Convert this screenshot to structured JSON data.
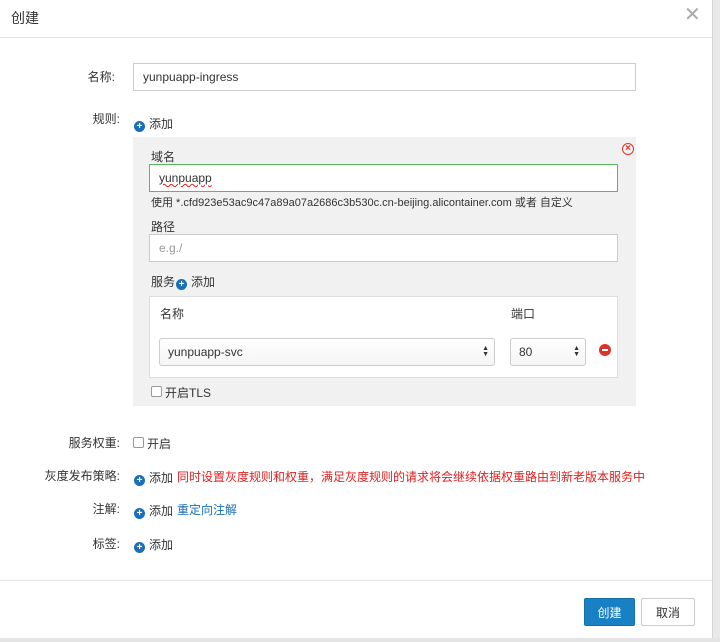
{
  "dialog": {
    "title": "创建",
    "close_glyph": "✕"
  },
  "form": {
    "name_label": "名称:",
    "name_value": "yunpuapp-ingress",
    "rules_label": "规则:",
    "add_label": "添加",
    "rule": {
      "domain_label": "域名",
      "domain_value": "yunpuapp",
      "domain_hint": "使用 *.cfd923e53ac9c47a89a07a2686c3b530c.cn-beijing.alicontainer.com 或者 自定义",
      "path_label": "路径",
      "path_placeholder": "e.g./",
      "service_label": "服务",
      "service_add_label": "添加",
      "service_table": {
        "name_header": "名称",
        "port_header": "端口",
        "service_selected": "yunpuapp-svc",
        "port_selected": "80"
      },
      "tls_label": "开启TLS",
      "tls_checked": false
    },
    "weight_label": "服务权重:",
    "weight_option_label": "开启",
    "weight_checked": false,
    "gray_label": "灰度发布策略:",
    "gray_add_label": "添加",
    "gray_warning": "同时设置灰度规则和权重，满足灰度规则的请求将会继续依据权重路由到新老版本服务中",
    "annotation_label": "注解:",
    "annotation_add_label": "添加",
    "annotation_link": "重定向注解",
    "tags_label": "标签:",
    "tags_add_label": "添加"
  },
  "footer": {
    "create_button": "创建",
    "cancel_button": "取消"
  },
  "colors": {
    "primary": "#1a80c4",
    "link": "#1a6fb6",
    "danger": "#d9352b",
    "warning_text": "#e02020",
    "valid_border": "#5cb85c"
  },
  "icons": {
    "add": "plus-circle-icon",
    "remove_rule": "close-circle-icon",
    "remove_row": "minus-circle-icon",
    "select_arrows": "updown-arrows-icon"
  }
}
